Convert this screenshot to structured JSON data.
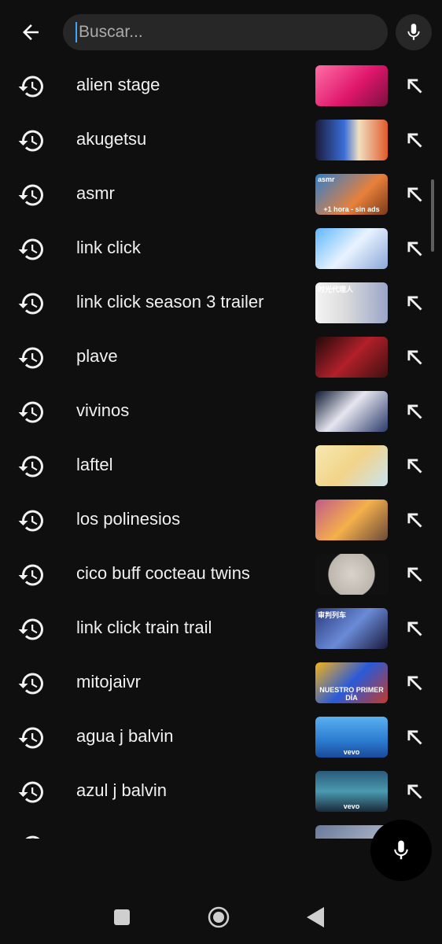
{
  "search": {
    "placeholder": "Buscar..."
  },
  "icons": {
    "back": "arrow-left-icon",
    "mic": "microphone-icon",
    "history": "history-clock-icon",
    "fill": "arrow-up-left-icon"
  },
  "colors": {
    "background": "#0f0f0f",
    "search_field": "#272727",
    "text": "#f1f1f1",
    "accent_cursor": "#3ea6ff"
  },
  "suggestions": [
    {
      "label": "alien stage",
      "thumb_bg": "linear-gradient(135deg,#ff6fa6,#e0166c 55%,#7a1040)"
    },
    {
      "label": "akugetsu",
      "thumb_bg": "linear-gradient(90deg,#1a1a3a,#3a6ed8 40%,#f0e0c0 60%,#e25a2a)"
    },
    {
      "label": "asmr",
      "thumb_bg": "linear-gradient(135deg,#2c7fd0,#e7803a 60%,#7b3a1a)",
      "thumb_top": "asmr",
      "thumb_caption": "+1 hora - sin ads"
    },
    {
      "label": "link click",
      "thumb_bg": "linear-gradient(135deg,#5fb7ff,#e9f3ff 50%,#8aa7d8)"
    },
    {
      "label": "link click season 3 trailer",
      "thumb_bg": "linear-gradient(90deg,#f4f4f4,#dcdcdc 40%,#9aa6c8)",
      "thumb_top": "时光代理人"
    },
    {
      "label": "plave",
      "thumb_bg": "linear-gradient(135deg,#200a0a,#b0202a 50%,#401010)"
    },
    {
      "label": "vivinos",
      "thumb_bg": "linear-gradient(135deg,#0e1830,#e6e6f0 45%,#2a3a6a)"
    },
    {
      "label": "laftel",
      "thumb_bg": "linear-gradient(135deg,#f6e9b0,#f2d38a 50%,#c9e4f0)"
    },
    {
      "label": "los polinesios",
      "thumb_bg": "linear-gradient(135deg,#c25a8a,#f5b04a 50%,#6a4a3a)"
    },
    {
      "label": "cico buff cocteau twins",
      "thumb_bg": "radial-gradient(circle at 50% 50%,#d8d3cc 0%,#bdb6ad 55%,#111 57%)"
    },
    {
      "label": "link click train trail",
      "thumb_bg": "linear-gradient(135deg,#2a3a7a,#6a8ad8 50%,#1a1a3a)",
      "thumb_top": "审判列车"
    },
    {
      "label": "mitojaivr",
      "thumb_bg": "linear-gradient(135deg,#f2b21a,#2a5ad8 50%,#c23a2a)",
      "thumb_caption": "NUESTRO PRIMER DÍA"
    },
    {
      "label": "agua j balvin",
      "thumb_bg": "linear-gradient(180deg,#5ab0f0,#2a7ad0 60%,#1a4a9a)",
      "thumb_caption": "vevo"
    },
    {
      "label": "azul j balvin",
      "thumb_bg": "linear-gradient(180deg,#2a5a7a,#4a9ab0 50%,#1a2a3a)",
      "thumb_caption": "vevo"
    }
  ]
}
